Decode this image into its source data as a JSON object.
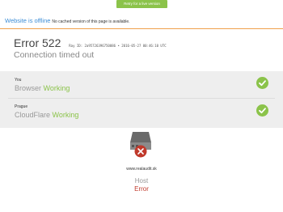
{
  "retry_button": {
    "label": "Retry for a live version"
  },
  "offline": {
    "title": "Website is offline",
    "message": "No cached version of this page is available."
  },
  "error": {
    "code_text": "Error 522",
    "ray_id": "Ray ID: 2a95726396750086 • 2016-05-27 00:46:10 UTC",
    "description": "Connection timed out"
  },
  "status_rows": [
    {
      "location": "You",
      "component": "Browser",
      "status": "Working",
      "icon": "check-icon"
    },
    {
      "location": "Prague",
      "component": "CloudFlare",
      "status": "Working",
      "icon": "check-icon"
    }
  ],
  "host": {
    "domain": "www.realaudit.sk",
    "label": "Host",
    "status": "Error",
    "icon": "server-error-icon"
  },
  "colors": {
    "accent_green": "#8bc34a",
    "link_blue": "#3c8dd6",
    "error_red": "#c0392b",
    "separator_orange": "#f0a04b"
  }
}
